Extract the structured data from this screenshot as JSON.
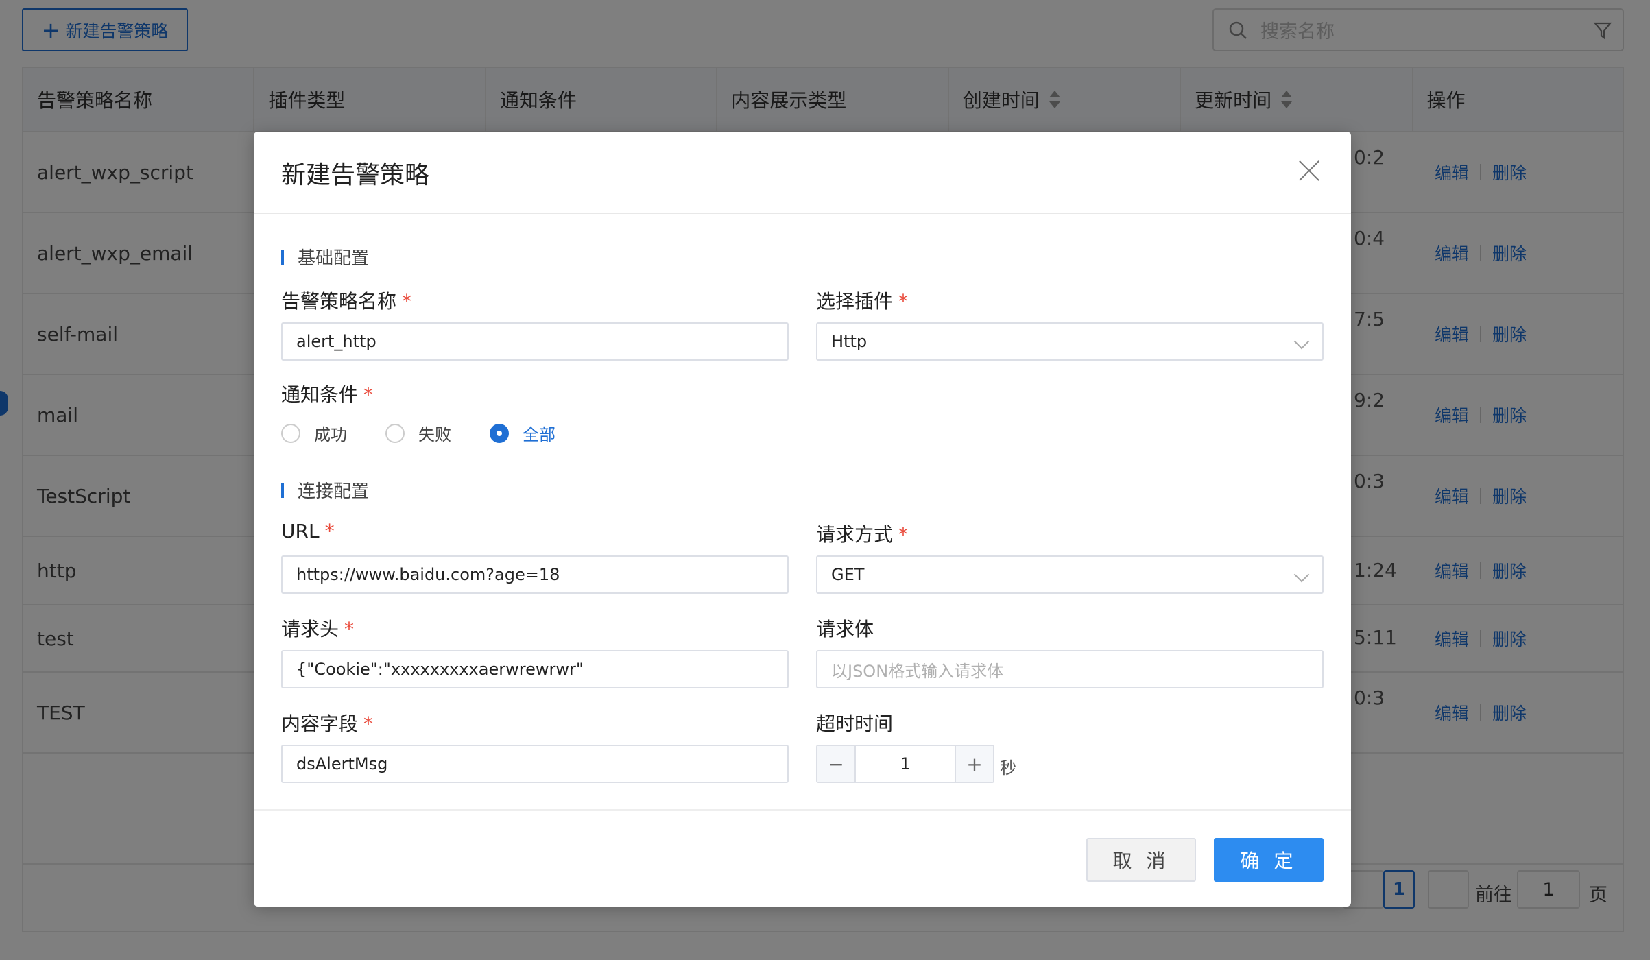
{
  "toolbar": {
    "new_button_icon": "plus-icon",
    "new_button_label": "新建告警策略"
  },
  "search": {
    "placeholder": "搜索名称",
    "icon": "search-icon",
    "filter_icon": "filter-icon"
  },
  "table": {
    "columns": [
      "告警策略名称",
      "插件类型",
      "通知条件",
      "内容展示类型",
      "创建时间",
      "更新时间",
      "操作"
    ],
    "rows": [
      {
        "name": "alert_wxp_script",
        "updated": "0:2"
      },
      {
        "name": "alert_wxp_email",
        "updated": "0:4"
      },
      {
        "name": "self-mail",
        "updated": "7:5"
      },
      {
        "name": "mail",
        "updated": "9:2"
      },
      {
        "name": "TestScript",
        "updated": "0:3"
      },
      {
        "name": "http",
        "updated": "1:24"
      },
      {
        "name": "test",
        "updated": "5:11"
      },
      {
        "name": "TEST",
        "updated": "0:3"
      }
    ],
    "actions": {
      "edit": "编辑",
      "delete": "删除"
    }
  },
  "pagination": {
    "current_page": "1",
    "goto_label": "前往",
    "goto_value": "1",
    "page_unit": "页"
  },
  "dialog": {
    "title": "新建告警策略",
    "section_basic": "基础配置",
    "section_connection": "连接配置",
    "required_mark": "*",
    "fields": {
      "policy_name": {
        "label": "告警策略名称",
        "value": "alert_http"
      },
      "plugin": {
        "label": "选择插件",
        "value": "Http"
      },
      "notify_condition": {
        "label": "通知条件",
        "options": [
          "成功",
          "失败",
          "全部"
        ],
        "selected": "全部"
      },
      "url": {
        "label": "URL",
        "value": "https://www.baidu.com?age=18"
      },
      "method": {
        "label": "请求方式",
        "value": "GET"
      },
      "headers": {
        "label": "请求头",
        "value": "{\"Cookie\":\"xxxxxxxxxaerwrewrwr\""
      },
      "body": {
        "label": "请求体",
        "placeholder": "以JSON格式输入请求体"
      },
      "content_field": {
        "label": "内容字段",
        "value": "dsAlertMsg"
      },
      "timeout": {
        "label": "超时时间",
        "value": "1",
        "unit": "秒",
        "minus": "−",
        "plus": "+"
      }
    },
    "cancel_label": "取 消",
    "confirm_label": "确 定"
  },
  "colors": {
    "primary": "#1f6fd4",
    "confirm": "#2d8cf0",
    "required": "#e94b3c"
  }
}
